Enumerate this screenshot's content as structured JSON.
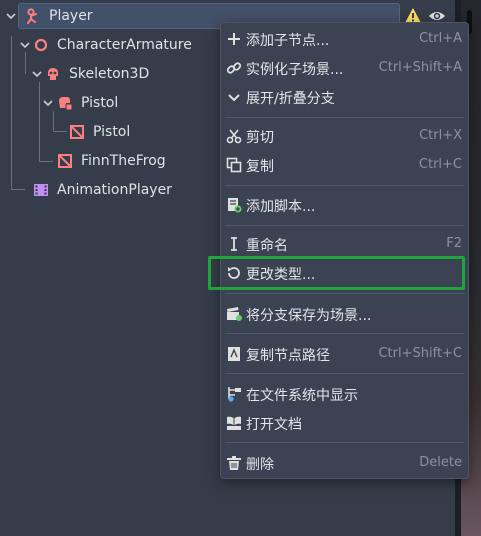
{
  "colors": {
    "panel_bg": "#363d4a",
    "selected_row": "#435069",
    "menu_bg": "#3b4352",
    "node_red": "#fc7f7f",
    "anim_purple": "#c38ef1",
    "highlight_green": "#21a33c",
    "warning_yellow": "#ffdd65"
  },
  "tree": {
    "nodes": [
      {
        "label": "Player",
        "icon": "player-node-icon"
      },
      {
        "label": "CharacterArmature",
        "icon": "node3d-circle-icon"
      },
      {
        "label": "Skeleton3D",
        "icon": "skull-icon"
      },
      {
        "label": "Pistol",
        "icon": "scene-instance-icon"
      },
      {
        "label": "Pistol",
        "icon": "mesh-instance-icon"
      },
      {
        "label": "FinnTheFrog",
        "icon": "mesh-instance-icon"
      },
      {
        "label": "AnimationPlayer",
        "icon": "animation-player-icon"
      }
    ]
  },
  "menu": {
    "items": [
      {
        "label": "添加子节点...",
        "shortcut": "Ctrl+A",
        "icon": "plus-icon"
      },
      {
        "label": "实例化子场景...",
        "shortcut": "Ctrl+Shift+A",
        "icon": "link-icon"
      },
      {
        "label": "展开/折叠分支",
        "shortcut": "",
        "icon": "chevron-down-icon"
      },
      {
        "label": "剪切",
        "shortcut": "Ctrl+X",
        "icon": "scissors-icon"
      },
      {
        "label": "复制",
        "shortcut": "Ctrl+C",
        "icon": "copy-icon"
      },
      {
        "label": "添加脚本...",
        "shortcut": "",
        "icon": "script-add-icon"
      },
      {
        "label": "重命名",
        "shortcut": "F2",
        "icon": "rename-icon"
      },
      {
        "label": "更改类型...",
        "shortcut": "",
        "icon": "rotate-icon"
      },
      {
        "label": "将分支保存为场景...",
        "shortcut": "",
        "icon": "clapper-icon"
      },
      {
        "label": "复制节点路径",
        "shortcut": "Ctrl+Shift+C",
        "icon": "path-copy-icon"
      },
      {
        "label": "在文件系统中显示",
        "shortcut": "",
        "icon": "filesystem-icon"
      },
      {
        "label": "打开文档",
        "shortcut": "",
        "icon": "book-icon"
      },
      {
        "label": "删除",
        "shortcut": "Delete",
        "icon": "trash-icon"
      }
    ]
  }
}
